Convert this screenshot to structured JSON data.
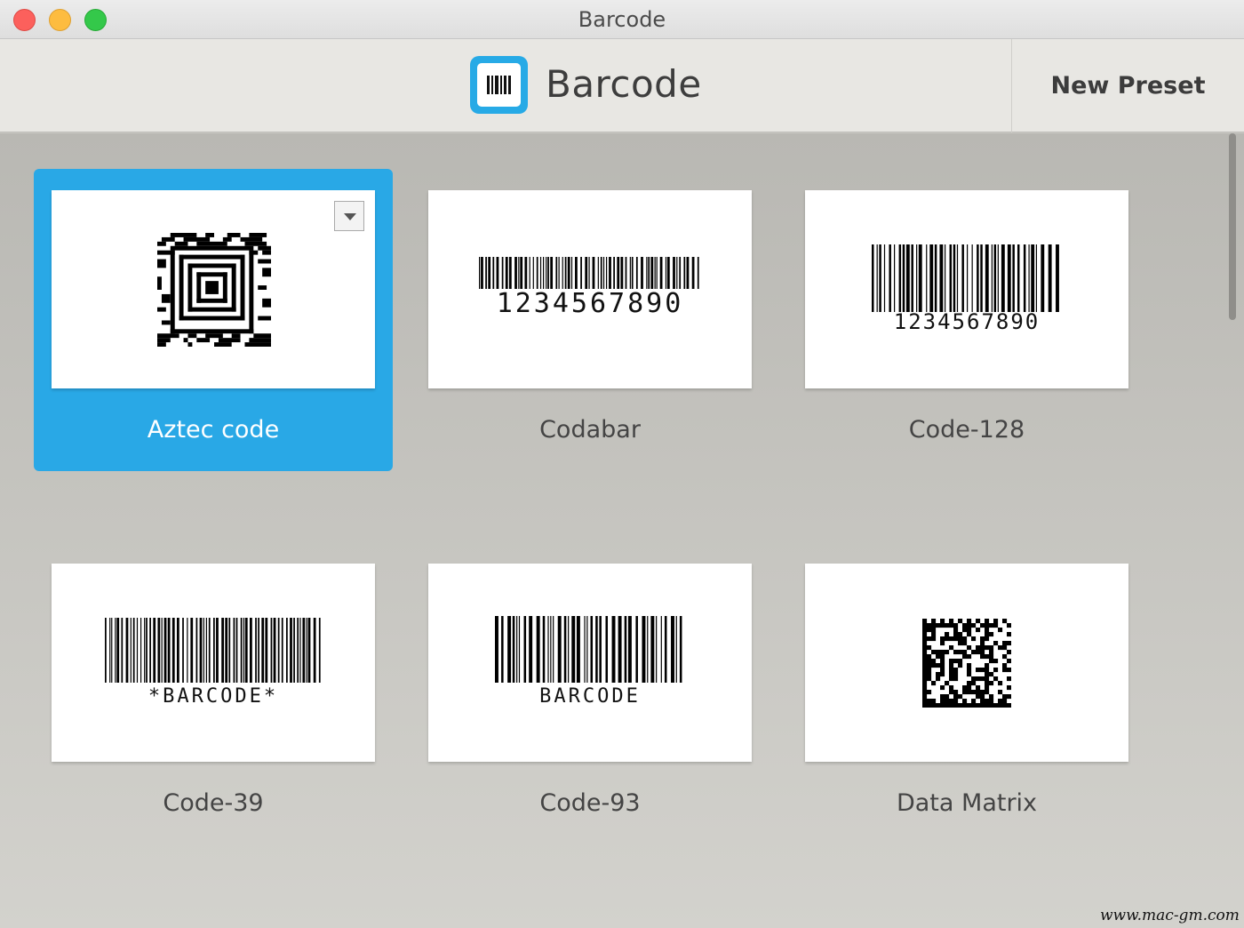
{
  "window": {
    "title": "Barcode"
  },
  "toolbar": {
    "app_name": "Barcode",
    "new_preset_label": "New Preset"
  },
  "tiles": [
    {
      "label": "Aztec code",
      "selected": true
    },
    {
      "label": "Codabar",
      "code_text": "1234567890"
    },
    {
      "label": "Code-128",
      "code_text": "1234567890"
    },
    {
      "label": "Code-39",
      "code_text": "*BARCODE*"
    },
    {
      "label": "Code-93",
      "code_text": "BARCODE"
    },
    {
      "label": "Data Matrix"
    }
  ],
  "accent_color": "#29a8e6",
  "watermark": "www.mac-gm.com"
}
